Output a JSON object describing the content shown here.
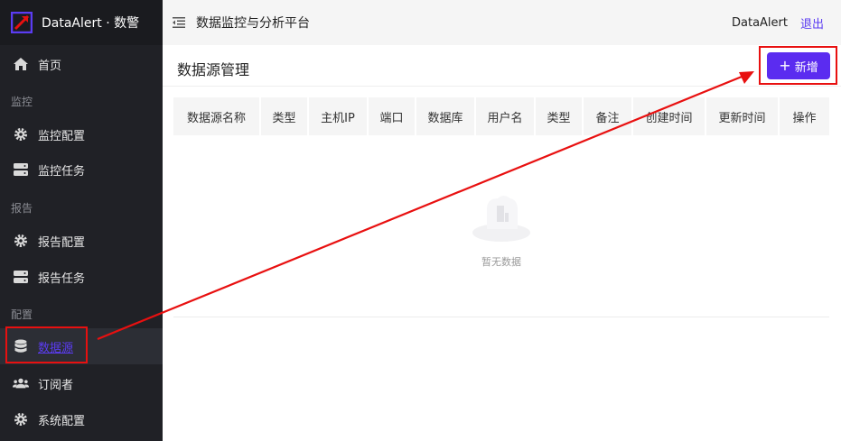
{
  "app": {
    "brand": "DataAlert · 数警"
  },
  "sidebar": {
    "items": [
      {
        "label": "首页",
        "icon": "home-icon"
      },
      {
        "label": "监控配置",
        "icon": "gear-icon"
      },
      {
        "label": "监控任务",
        "icon": "server-icon"
      },
      {
        "label": "报告配置",
        "icon": "gear-icon"
      },
      {
        "label": "报告任务",
        "icon": "server-icon"
      },
      {
        "label": "数据源",
        "icon": "database-icon",
        "active": true
      },
      {
        "label": "订阅者",
        "icon": "users-icon"
      },
      {
        "label": "系统配置",
        "icon": "gear-icon"
      }
    ],
    "groups": [
      "监控",
      "报告",
      "配置"
    ]
  },
  "header": {
    "platform": "数据监控与分析平台",
    "user": "DataAlert",
    "logout": "退出"
  },
  "page": {
    "title": "数据源管理",
    "add_label": "新增",
    "columns": [
      "数据源名称",
      "类型",
      "主机IP",
      "端口",
      "数据库",
      "用户名",
      "类型",
      "备注",
      "创建时间",
      "更新时间",
      "操作"
    ],
    "rows": [],
    "empty_text": "暂无数据"
  },
  "colors": {
    "accent": "#5b2cf0",
    "sidebar_bg": "#202126",
    "annotation": "#e81010"
  }
}
